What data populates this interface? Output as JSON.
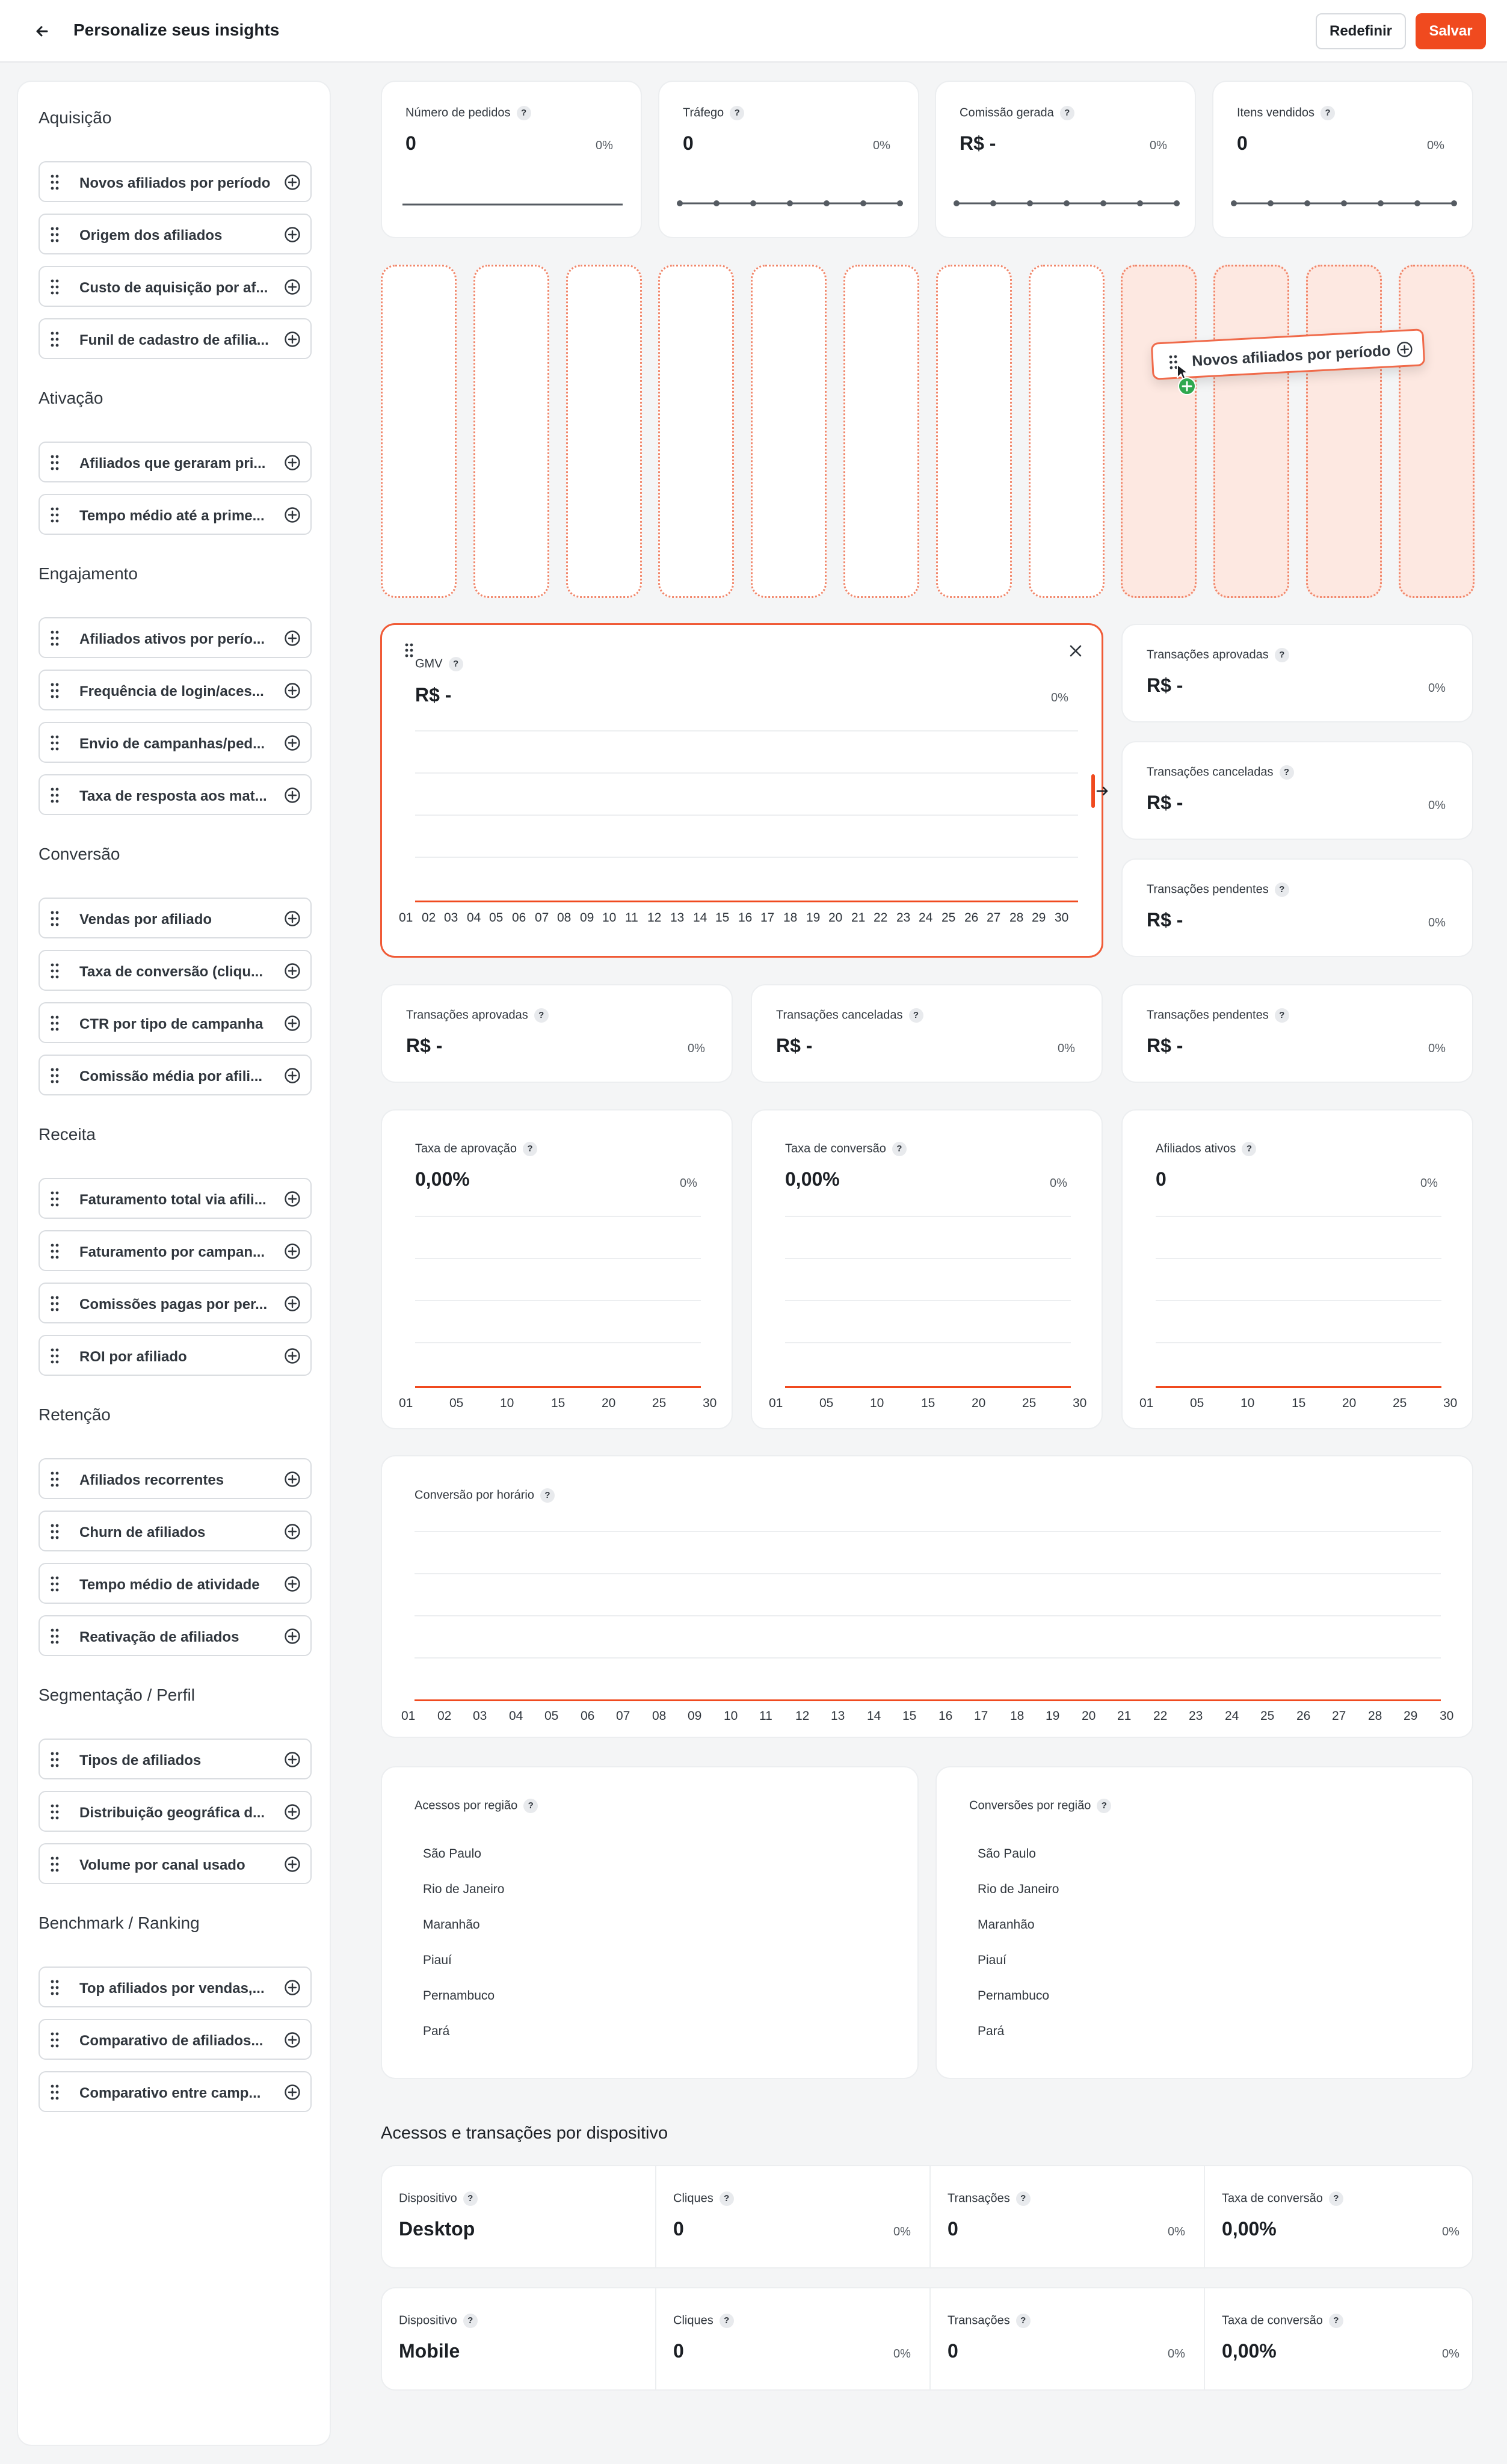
{
  "header": {
    "title": "Personalize seus insights",
    "reset_label": "Redefinir",
    "save_label": "Salvar",
    "accent_color": "#F04A1F"
  },
  "sidebar": {
    "sections": [
      {
        "title": "Aquisição",
        "items": [
          "Novos afiliados por período",
          "Origem dos afiliados",
          "Custo de aquisição por af...",
          "Funil de cadastro de afilia..."
        ]
      },
      {
        "title": "Ativação",
        "items": [
          "Afiliados que geraram pri...",
          "Tempo médio até a prime..."
        ]
      },
      {
        "title": "Engajamento",
        "items": [
          "Afiliados ativos por perío...",
          "Frequência de login/aces...",
          "Envio de campanhas/ped...",
          "Taxa de resposta aos mat..."
        ]
      },
      {
        "title": "Conversão",
        "items": [
          "Vendas por afiliado",
          "Taxa de conversão (cliqu...",
          "CTR por tipo de campanha",
          "Comissão média por afili..."
        ]
      },
      {
        "title": "Receita",
        "items": [
          "Faturamento total via afili...",
          "Faturamento por campan...",
          "Comissões pagas por per...",
          "ROI por afiliado"
        ]
      },
      {
        "title": "Retenção",
        "items": [
          "Afiliados recorrentes",
          "Churn de afiliados",
          "Tempo médio de atividade",
          "Reativação de afiliados"
        ]
      },
      {
        "title": "Segmentação / Perfil",
        "items": [
          "Tipos de afiliados",
          "Distribuição geográfica d...",
          "Volume por canal usado"
        ]
      },
      {
        "title": "Benchmark / Ranking",
        "items": [
          "Top afiliados por vendas,...",
          "Comparativo de afiliados...",
          "Comparativo entre camp..."
        ]
      }
    ]
  },
  "top_cards": [
    {
      "label": "Número de pedidos",
      "value": "0",
      "pct": "0%"
    },
    {
      "label": "Tráfego",
      "value": "0",
      "pct": "0%"
    },
    {
      "label": "Comissão gerada",
      "value": "R$ -",
      "pct": "0%"
    },
    {
      "label": "Itens vendidos",
      "value": "0",
      "pct": "0%"
    }
  ],
  "dragging": {
    "label": "Novos afiliados por período"
  },
  "gmv": {
    "label": "GMV",
    "value": "R$ -",
    "pct": "0%",
    "x_ticks": [
      "01",
      "02",
      "03",
      "04",
      "05",
      "06",
      "07",
      "08",
      "09",
      "10",
      "11",
      "12",
      "13",
      "14",
      "15",
      "16",
      "17",
      "18",
      "19",
      "20",
      "21",
      "22",
      "23",
      "24",
      "25",
      "26",
      "27",
      "28",
      "29",
      "30"
    ]
  },
  "side_cards": [
    {
      "label": "Transações aprovadas",
      "value": "R$ -",
      "pct": "0%"
    },
    {
      "label": "Transações canceladas",
      "value": "R$ -",
      "pct": "0%"
    },
    {
      "label": "Transações pendentes",
      "value": "R$ -",
      "pct": "0%"
    }
  ],
  "row_cards": [
    {
      "label": "Transações aprovadas",
      "value": "R$ -",
      "pct": "0%"
    },
    {
      "label": "Transações canceladas",
      "value": "R$ -",
      "pct": "0%"
    },
    {
      "label": "Transações pendentes",
      "value": "R$ -",
      "pct": "0%"
    }
  ],
  "mini_charts": [
    {
      "label": "Taxa de aprovação",
      "value": "0,00%",
      "pct": "0%",
      "x_ticks": [
        "01",
        "05",
        "10",
        "15",
        "20",
        "25",
        "30"
      ]
    },
    {
      "label": "Taxa de conversão",
      "value": "0,00%",
      "pct": "0%",
      "x_ticks": [
        "01",
        "05",
        "10",
        "15",
        "20",
        "25",
        "30"
      ]
    },
    {
      "label": "Afiliados ativos",
      "value": "0",
      "pct": "0%",
      "x_ticks": [
        "01",
        "05",
        "10",
        "15",
        "20",
        "25",
        "30"
      ]
    }
  ],
  "hourly": {
    "label": "Conversão por horário",
    "x_ticks": [
      "01",
      "02",
      "03",
      "04",
      "05",
      "06",
      "07",
      "08",
      "09",
      "10",
      "11",
      "12",
      "13",
      "14",
      "15",
      "16",
      "17",
      "18",
      "19",
      "20",
      "21",
      "22",
      "23",
      "24",
      "25",
      "26",
      "27",
      "28",
      "29",
      "30"
    ]
  },
  "regions": [
    {
      "label": "Acessos por região",
      "items": [
        "São Paulo",
        "Rio de Janeiro",
        "Maranhão",
        "Piauí",
        "Pernambuco",
        "Pará"
      ]
    },
    {
      "label": "Conversões por região",
      "items": [
        "São Paulo",
        "Rio de Janeiro",
        "Maranhão",
        "Piauí",
        "Pernambuco",
        "Pará"
      ]
    }
  ],
  "devices": {
    "title": "Acessos e transações por dispositivo",
    "rows": [
      {
        "device_label": "Dispositivo",
        "device": "Desktop",
        "clicks_label": "Cliques",
        "clicks": "0",
        "clicks_pct": "0%",
        "tx_label": "Transações",
        "tx": "0",
        "tx_pct": "0%",
        "conv_label": "Taxa de conversão",
        "conv": "0,00%",
        "conv_pct": "0%"
      },
      {
        "device_label": "Dispositivo",
        "device": "Mobile",
        "clicks_label": "Cliques",
        "clicks": "0",
        "clicks_pct": "0%",
        "tx_label": "Transações",
        "tx": "0",
        "tx_pct": "0%",
        "conv_label": "Taxa de conversão",
        "conv": "0,00%",
        "conv_pct": "0%"
      }
    ]
  }
}
